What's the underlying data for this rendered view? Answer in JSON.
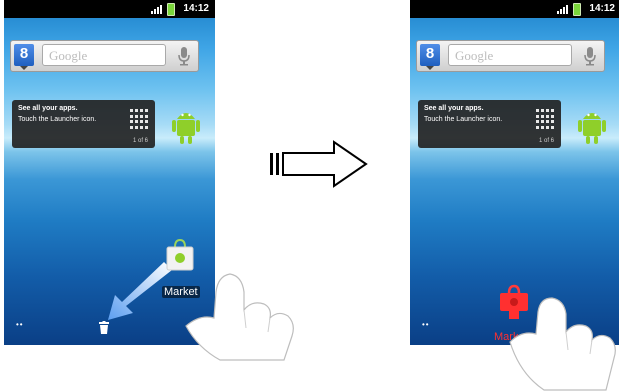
{
  "left_screen": {
    "status_time": "14:12",
    "search_placeholder": "Google",
    "google_letter": "8",
    "tip_title": "See all your apps.",
    "tip_body": "Touch the Launcher icon.",
    "tip_page": "1 of 6",
    "page_dots": "••",
    "dragged_app_label": "Market"
  },
  "right_screen": {
    "status_time": "14:12",
    "search_placeholder": "Google",
    "google_letter": "8",
    "tip_title": "See all your apps.",
    "tip_body": "Touch the Launcher icon.",
    "tip_page": "1 of 6",
    "page_dots": "••",
    "trash_app_label": "Market"
  },
  "colors": {
    "status_bar": "#000000",
    "battery": "#7ad63b",
    "market_drop_highlight": "#ff3030",
    "drag_arrow": "#7fb4f0"
  },
  "icons": [
    "signal-icon",
    "battery-icon",
    "google-search-icon",
    "mic-icon",
    "launcher-grid-icon",
    "android-icon",
    "trash-icon",
    "market-app-icon",
    "arrow-icon",
    "hand-icon"
  ]
}
